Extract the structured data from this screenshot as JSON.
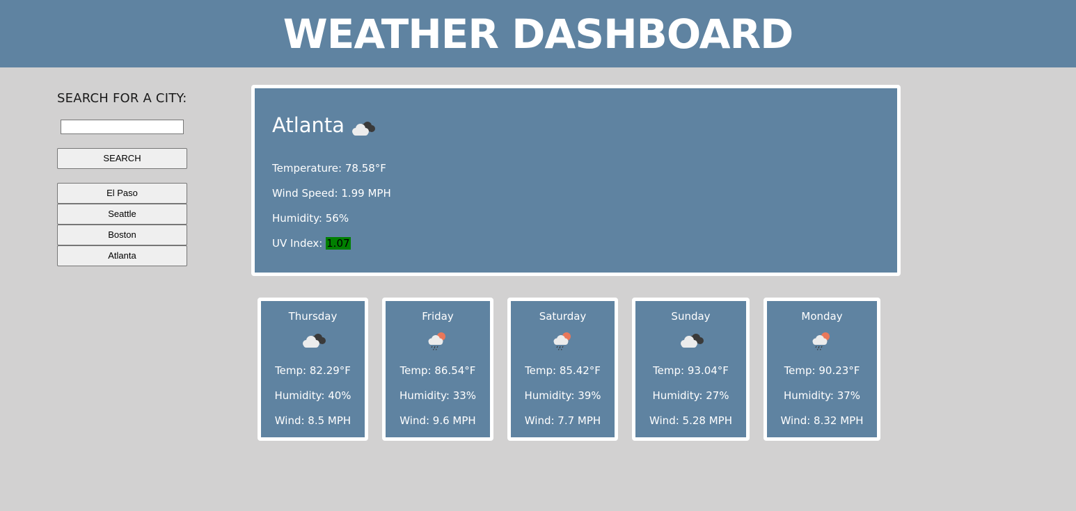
{
  "header": {
    "title": "WEATHER DASHBOARD"
  },
  "sidebar": {
    "search_label": "SEARCH FOR A CITY:",
    "search_value": "",
    "search_button": "SEARCH",
    "history": [
      "El Paso",
      "Seattle",
      "Boston",
      "Atlanta"
    ]
  },
  "current": {
    "city": "Atlanta",
    "icon": "cloudy-icon",
    "temperature_label": "Temperature:",
    "temperature": "78.58°F",
    "wind_label": "Wind Speed:",
    "wind": "1.99 MPH",
    "humidity_label": "Humidity:",
    "humidity": "56%",
    "uv_label": "UV Index:",
    "uv": "1.07",
    "uv_color": "#008000"
  },
  "forecast": [
    {
      "day": "Thursday",
      "icon": "cloudy-icon",
      "temp": "Temp: 82.29°F",
      "humidity": "Humidity: 40%",
      "wind": "Wind: 8.5 MPH"
    },
    {
      "day": "Friday",
      "icon": "rain-sun-icon",
      "temp": "Temp: 86.54°F",
      "humidity": "Humidity: 33%",
      "wind": "Wind: 9.6 MPH"
    },
    {
      "day": "Saturday",
      "icon": "rain-sun-icon",
      "temp": "Temp: 85.42°F",
      "humidity": "Humidity: 39%",
      "wind": "Wind: 7.7 MPH"
    },
    {
      "day": "Sunday",
      "icon": "cloudy-icon",
      "temp": "Temp: 93.04°F",
      "humidity": "Humidity: 27%",
      "wind": "Wind: 5.28 MPH"
    },
    {
      "day": "Monday",
      "icon": "rain-sun-icon",
      "temp": "Temp: 90.23°F",
      "humidity": "Humidity: 37%",
      "wind": "Wind: 8.32 MPH"
    }
  ],
  "colors": {
    "header_bg": "#5f83a1",
    "page_bg": "#d2d1d1",
    "card_bg": "#5f83a1",
    "card_border": "#ffffff"
  }
}
